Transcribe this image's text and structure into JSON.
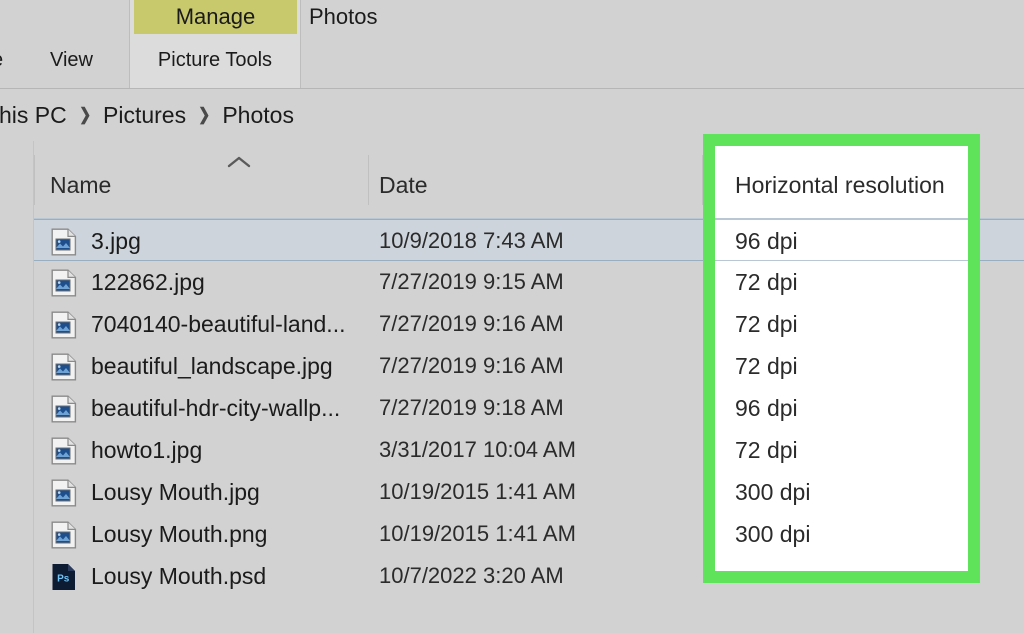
{
  "ribbon": {
    "clipped_tab": "e",
    "view_tab": "View",
    "manage_tab": "Manage",
    "photos_tab": "Photos",
    "contextual_group": "Picture Tools",
    "manage_tab_color": "#c8c86c"
  },
  "breadcrumb": {
    "items": [
      "his PC",
      "Pictures",
      "Photos"
    ],
    "separator": "❯"
  },
  "columns": {
    "name": "Name",
    "date": "Date",
    "horizontal_resolution": "Horizontal resolution",
    "sort_indicator": "ascending"
  },
  "highlight": {
    "color": "#5ee35a",
    "target_column": "Horizontal resolution"
  },
  "files": [
    {
      "name": "3.jpg",
      "date": "10/9/2018 7:43 AM",
      "resolution": "96 dpi",
      "icon": "image-file-icon",
      "selected": true
    },
    {
      "name": "122862.jpg",
      "date": "7/27/2019 9:15 AM",
      "resolution": "72 dpi",
      "icon": "image-file-icon",
      "selected": false
    },
    {
      "name": "7040140-beautiful-land...",
      "date": "7/27/2019 9:16 AM",
      "resolution": "72 dpi",
      "icon": "image-file-icon",
      "selected": false
    },
    {
      "name": "beautiful_landscape.jpg",
      "date": "7/27/2019 9:16 AM",
      "resolution": "72 dpi",
      "icon": "image-file-icon",
      "selected": false
    },
    {
      "name": "beautiful-hdr-city-wallp...",
      "date": "7/27/2019 9:18 AM",
      "resolution": "96 dpi",
      "icon": "image-file-icon",
      "selected": false
    },
    {
      "name": "howto1.jpg",
      "date": "3/31/2017 10:04 AM",
      "resolution": "72 dpi",
      "icon": "image-file-icon",
      "selected": false
    },
    {
      "name": "Lousy Mouth.jpg",
      "date": "10/19/2015 1:41 AM",
      "resolution": "300 dpi",
      "icon": "image-file-icon",
      "selected": false
    },
    {
      "name": "Lousy Mouth.png",
      "date": "10/19/2015 1:41 AM",
      "resolution": "300 dpi",
      "icon": "image-file-icon",
      "selected": false
    },
    {
      "name": "Lousy Mouth.psd",
      "date": "10/7/2022 3:20 AM",
      "resolution": "",
      "icon": "photoshop-file-icon",
      "selected": false
    }
  ]
}
